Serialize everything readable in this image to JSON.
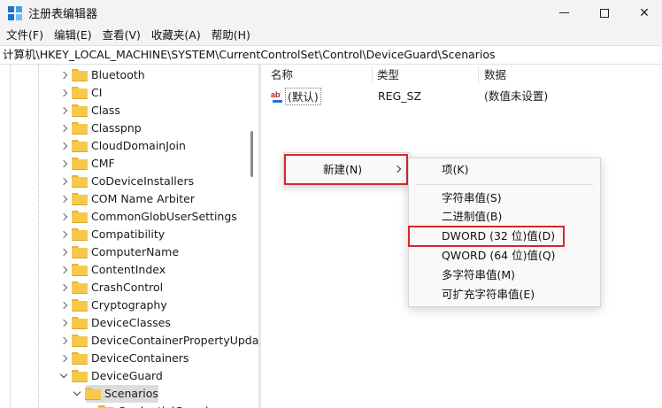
{
  "window": {
    "title": "注册表编辑器",
    "minimize": "—",
    "maximize": "☐",
    "close": "✕"
  },
  "menubar": {
    "items": [
      "文件(F)",
      "编辑(E)",
      "查看(V)",
      "收藏夹(A)",
      "帮助(H)"
    ]
  },
  "address": {
    "path": "计算机\\HKEY_LOCAL_MACHINE\\SYSTEM\\CurrentControlSet\\Control\\DeviceGuard\\Scenarios"
  },
  "tree": {
    "items": [
      {
        "label": "Bluetooth",
        "expanded": false
      },
      {
        "label": "CI",
        "expanded": false
      },
      {
        "label": "Class",
        "expanded": false
      },
      {
        "label": "Classpnp",
        "expanded": false
      },
      {
        "label": "CloudDomainJoin",
        "expanded": false
      },
      {
        "label": "CMF",
        "expanded": false
      },
      {
        "label": "CoDeviceInstallers",
        "expanded": false
      },
      {
        "label": "COM Name Arbiter",
        "expanded": false
      },
      {
        "label": "CommonGlobUserSettings",
        "expanded": false
      },
      {
        "label": "Compatibility",
        "expanded": false
      },
      {
        "label": "ComputerName",
        "expanded": false
      },
      {
        "label": "ContentIndex",
        "expanded": false
      },
      {
        "label": "CrashControl",
        "expanded": false
      },
      {
        "label": "Cryptography",
        "expanded": false
      },
      {
        "label": "DeviceClasses",
        "expanded": false
      },
      {
        "label": "DeviceContainerPropertyUpda",
        "expanded": false
      },
      {
        "label": "DeviceContainers",
        "expanded": false
      },
      {
        "label": "DeviceGuard",
        "expanded": true
      },
      {
        "label": "Scenarios",
        "expanded": true,
        "selected": true
      },
      {
        "label": "CredentialGuard",
        "expanded": false
      }
    ]
  },
  "list": {
    "columns": [
      "名称",
      "类型",
      "数据"
    ],
    "rows": [
      {
        "name": "(默认)",
        "type": "REG_SZ",
        "data": "(数值未设置)",
        "icon": "string-value-icon"
      }
    ]
  },
  "context_menu": {
    "new_label": "新建(N)"
  },
  "submenu": {
    "items": [
      "项(K)",
      "字符串值(S)",
      "二进制值(B)",
      "DWORD (32 位)值(D)",
      "QWORD (64 位)值(Q)",
      "多字符串值(M)",
      "可扩充字符串值(E)"
    ]
  },
  "colors": {
    "highlight": "#d9262a",
    "folder": "#f6c94a",
    "selected_row": "#dcdcdc"
  }
}
